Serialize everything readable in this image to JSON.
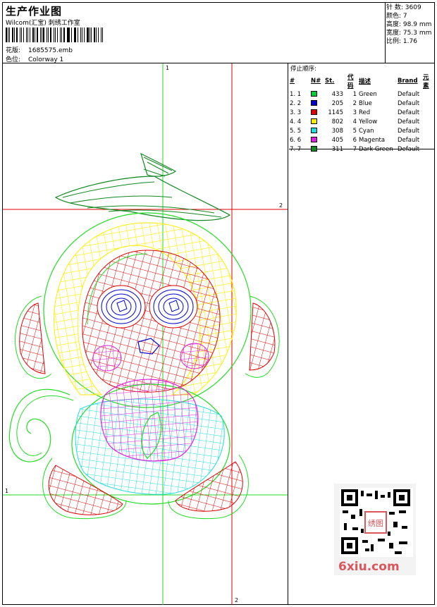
{
  "header": {
    "title": "生产作业图",
    "company": "Wilcom(汇宝) 刺绣工作室",
    "pattern_label": "花版:",
    "pattern_value": "1685575.emb",
    "colorway_label": "色位:",
    "colorway_value": "Colorway 1"
  },
  "stats": {
    "stitches_label": "针 数:",
    "stitches_value": "3609",
    "colors_label": "颜色:",
    "colors_value": "7",
    "height_label": "高度:",
    "height_value": "98.9 mm",
    "width_label": "宽度:",
    "width_value": "75.3 mm",
    "scale_label": "比例:",
    "scale_value": "1.76"
  },
  "legend": {
    "title": "停止顺序:",
    "headers": [
      "#",
      "N#",
      "St.",
      "代码",
      "描述",
      "Brand",
      "元素"
    ],
    "rows": [
      {
        "num": "1. 1",
        "color": "#00cc33",
        "st": "433",
        "code": "1",
        "desc": "Green",
        "brand": "Default"
      },
      {
        "num": "2. 2",
        "color": "#0000cc",
        "st": "205",
        "code": "2",
        "desc": "Blue",
        "brand": "Default"
      },
      {
        "num": "3. 3",
        "color": "#dd0000",
        "st": "1145",
        "code": "3",
        "desc": "Red",
        "brand": "Default"
      },
      {
        "num": "4. 4",
        "color": "#ffee00",
        "st": "802",
        "code": "4",
        "desc": "Yellow",
        "brand": "Default"
      },
      {
        "num": "5. 5",
        "color": "#22dddd",
        "st": "308",
        "code": "5",
        "desc": "Cyan",
        "brand": "Default"
      },
      {
        "num": "6. 6",
        "color": "#dd22dd",
        "st": "405",
        "code": "6",
        "desc": "Magenta",
        "brand": "Default"
      },
      {
        "num": "7. 7",
        "color": "#118822",
        "st": "311",
        "code": "7",
        "desc": "Dark Green",
        "brand": "Default"
      }
    ]
  },
  "design": {
    "axis_marks": {
      "top": "1",
      "right": "2",
      "left": "1",
      "bottom": "2"
    },
    "colors": {
      "green": "#22dd22",
      "red": "#dd0000",
      "blue": "#0000cc",
      "yellow": "#ffee00",
      "cyan": "#22dddd",
      "magenta": "#dd22dd",
      "dark_green": "#118822"
    }
  },
  "watermark": {
    "text": "6xiu.com",
    "qr_text": "绣图"
  }
}
